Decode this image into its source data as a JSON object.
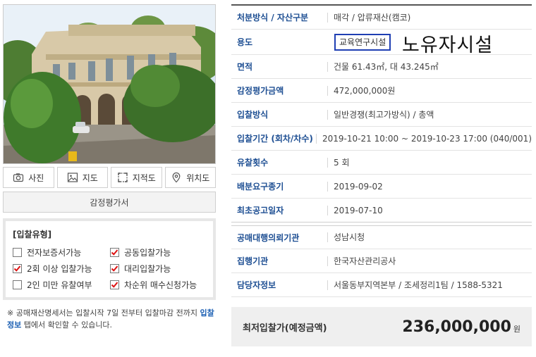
{
  "photo_buttons": [
    {
      "label": "사진",
      "icon": "camera-icon"
    },
    {
      "label": "지도",
      "icon": "image-icon"
    },
    {
      "label": "지적도",
      "icon": "cadastral-map-icon"
    },
    {
      "label": "위치도",
      "icon": "location-pin-icon"
    }
  ],
  "appraisal_label": "감정평가서",
  "bid_type": {
    "title": "[입찰유형]",
    "options": [
      {
        "label": "전자보증서가능",
        "checked": false
      },
      {
        "label": "공동입찰가능",
        "checked": true
      },
      {
        "label": "2회 이상 입찰가능",
        "checked": true
      },
      {
        "label": "대리입찰가능",
        "checked": true
      },
      {
        "label": "2인 미만 유찰여부",
        "checked": false
      },
      {
        "label": "차순위 매수신청가능",
        "checked": true
      }
    ]
  },
  "note": {
    "before": "※ 공매재산명세서는 입찰시작 7일 전부터 입찰마감 전까지 ",
    "link": "입찰정보",
    "after": " 탭에서 확인할 수 있습니다."
  },
  "info": {
    "disposal_label": "처분방식 / 자산구분",
    "disposal_value": "매각 / 압류재산(캠코)",
    "usage_label": "용도",
    "usage_value": "교육연구시설",
    "annotation": "노유자시설",
    "area_label": "면적",
    "area_value": "건물 61.43㎡, 대 43.245㎡",
    "appraisal_price_label": "감정평가금액",
    "appraisal_price_value": "472,000,000원",
    "bid_method_label": "입찰방식",
    "bid_method_value": "일반경쟁(최고가방식) / 총액",
    "bid_period_label": "입찰기간 (회차/차수)",
    "bid_period_value": "2019-10-21 10:00 ~ 2019-10-23 17:00 (040/001)",
    "failed_count_label": "유찰횟수",
    "failed_count_value": "5 회",
    "distribution_deadline_label": "배분요구종기",
    "distribution_deadline_value": "2019-09-02",
    "first_notice_label": "최초공고일자",
    "first_notice_value": "2019-07-10",
    "agency_label": "공매대행의뢰기관",
    "agency_value": "성남시청",
    "executor_label": "집행기관",
    "executor_value": "한국자산관리공사",
    "contact_label": "담당자정보",
    "contact_value": "서울동부지역본부 / 조세정리1팀 / 1588-5321"
  },
  "min_price": {
    "label": "최저입찰가(예정금액)",
    "value": "236,000,000",
    "unit": "원"
  }
}
